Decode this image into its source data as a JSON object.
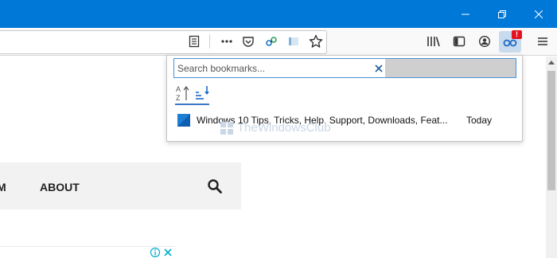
{
  "window": {
    "controls": [
      "minimize",
      "restore",
      "close"
    ]
  },
  "toolbar": {
    "url_actions": [
      "reader-view-icon",
      "page-actions-menu-icon",
      "pocket-icon",
      "extension-icon",
      "screenshot-icon",
      "bookmark-star-icon"
    ],
    "right_icons": [
      "library-icon",
      "sidebar-icon",
      "account-icon",
      "bookmark-search-extension-icon",
      "hamburger-menu-icon"
    ],
    "badge_text": "!"
  },
  "page": {
    "nav_items": [
      "M",
      "ABOUT"
    ]
  },
  "popup": {
    "search_placeholder": "Search bookmarks...",
    "sort_options": [
      "sort-alphabetical",
      "sort-by-date"
    ],
    "bookmarks": [
      {
        "title": "Windows 10 Tips, Tricks, Help, Support, Downloads, Feat...",
        "date": "Today"
      }
    ]
  },
  "watermark": {
    "text": "TheWindowsClub"
  },
  "colors": {
    "titlebar": "#0078d7",
    "badge": "#e3141f",
    "active_extension": "#c9dbef",
    "search_focus": "#4a90d9"
  }
}
